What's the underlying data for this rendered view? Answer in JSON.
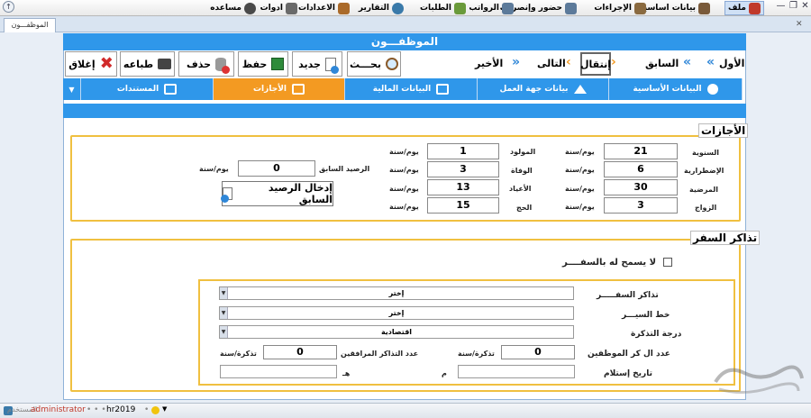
{
  "menubar": {
    "items": [
      {
        "name": "file",
        "label": "ملف",
        "color": "#c0392b"
      },
      {
        "name": "basic-data",
        "label": "بيانات اساسية",
        "color": "#7a5a3a"
      },
      {
        "name": "procedures",
        "label": "الإجراءات",
        "color": "#8a6a40"
      },
      {
        "name": "attendance",
        "label": "حضور وإنصراف",
        "color": "#5c7a9a"
      },
      {
        "name": "salaries",
        "label": "الرواتب",
        "color": "#5c7a9a"
      },
      {
        "name": "requests",
        "label": "الطلبات",
        "color": "#6a9a3a"
      },
      {
        "name": "reports",
        "label": "التقارير",
        "color": "#3a7aaa"
      },
      {
        "name": "settings",
        "label": "الاعدادات",
        "color": "#aa6a2a"
      },
      {
        "name": "tools",
        "label": "ادوات",
        "color": "#6a6a6a"
      },
      {
        "name": "help",
        "label": "مساعده",
        "color": "#4a4a4a"
      }
    ]
  },
  "doc_tab": "الموظفـــون",
  "window": {
    "title": "الموظفـــون"
  },
  "nav": {
    "first": "الأول",
    "prev": "السابق",
    "goto": "إنتقال",
    "next": "التالى",
    "last": "الأخير"
  },
  "toolbar": {
    "search": "بحـــث",
    "new": "جديد",
    "save": "حفظ",
    "delete": "حذف",
    "print": "طباعه",
    "close": "إغلاق"
  },
  "tabs": [
    {
      "label": "البيانات الأساسية",
      "icon": "user-icon"
    },
    {
      "label": "بيانات جهة العمل",
      "icon": "home-icon"
    },
    {
      "label": "البيانات المالية",
      "icon": "grid-icon"
    },
    {
      "label": "الأجازات",
      "icon": "calendar-icon"
    },
    {
      "label": "المستندات",
      "icon": "document-icon"
    }
  ],
  "leaves": {
    "title": "الأجازات",
    "unit": "يوم/سنة",
    "col1": [
      {
        "label": "السنوية",
        "value": "21"
      },
      {
        "label": "الإضطرارية",
        "value": "6"
      },
      {
        "label": "المرضية",
        "value": "30"
      },
      {
        "label": "الزواج",
        "value": "3"
      }
    ],
    "col2": [
      {
        "label": "المولود",
        "value": "1"
      },
      {
        "label": "الوفاة",
        "value": "3"
      },
      {
        "label": "الأعياد",
        "value": "13"
      },
      {
        "label": "الحج",
        "value": "15"
      }
    ],
    "prev_balance_label": "الرصيد السابق",
    "prev_balance_value": "0",
    "enter_prev_balance": "إدخال الرصيد السابق"
  },
  "tickets": {
    "title": "تذاكر السفر",
    "not_allowed": "لا يسمح له بالسفــــر",
    "tickets_label": "تذاكر السفـــــر",
    "tickets_value": "إختر",
    "route_label": "خط السيـــر",
    "route_value": "إختر",
    "class_label": "درجة التذكرة",
    "class_value": "اقتصادية",
    "emp_count_label": "عدد ال    كر الموظفين",
    "emp_count_value": "0",
    "ticket_unit": "تذكرة/سنة",
    "comp_count_label": "عدد التذاكر المرافقين",
    "comp_count_value": "0",
    "date_label": "تاريخ  إستلام",
    "m_label": "م",
    "h_label": "هـ"
  },
  "status": {
    "user_label": "المستخدم",
    "user": "administrator",
    "db": "hr2019"
  }
}
